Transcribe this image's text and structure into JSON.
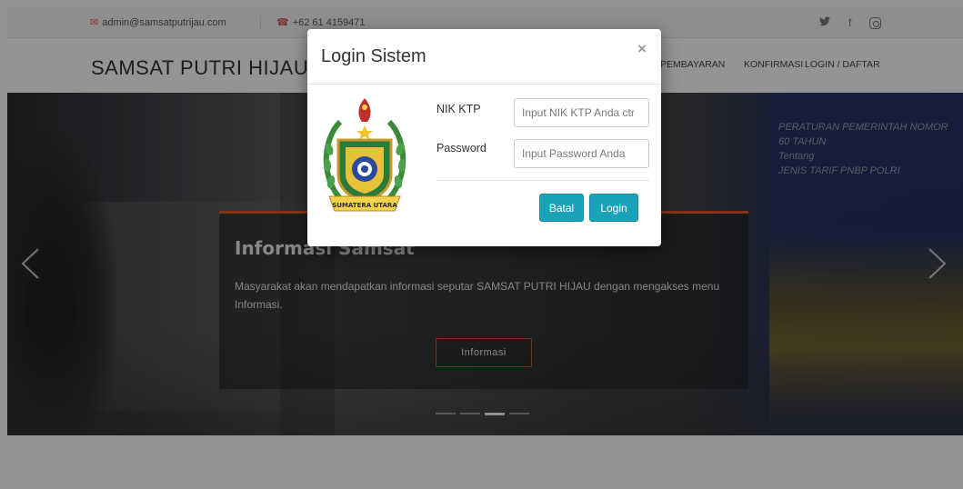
{
  "topbar": {
    "email": "admin@samsatputrijau.com",
    "phone": "+62 61 4159471",
    "email_icon": "envelope-icon",
    "phone_icon": "phone-icon",
    "social_icons": [
      "twitter-icon",
      "facebook-icon",
      "instagram-icon"
    ],
    "twitter_glyph": "𝕪",
    "facebook_glyph": "f"
  },
  "header": {
    "brand": "SAMSAT PUTRI HIJAU",
    "nav": [
      "PEMBAYARAN",
      "KONFIRMASI",
      "LOGIN / DAFTAR"
    ]
  },
  "hero": {
    "board_text": "PERATURAN PEMERINTAH NOMOR 60 TAHUN\nTentang\nJENIS TARIF PNBP POLRI",
    "caption_title": "Informasi Samsat",
    "caption_text": "Masyarakat akan mendapatkan informasi seputar SAMSAT PUTRI HIJAU dengan mengakses menu Informasi.",
    "caption_button": "Informasi",
    "indicator_count": 4,
    "active_indicator": 2
  },
  "modal": {
    "title": "Login Sistem",
    "close_label": "×",
    "logo_text": "SUMATERA UTARA",
    "nik_label": "NIK KTP",
    "nik_placeholder": "Input NIK KTP Anda ctr",
    "password_label": "Password",
    "password_placeholder": "Input Password Anda",
    "cancel_label": "Batal",
    "login_label": "Login"
  },
  "colors": {
    "accent": "#1aa3b8",
    "caption_border": "#e05a2a",
    "icon_red": "#d9534f"
  }
}
